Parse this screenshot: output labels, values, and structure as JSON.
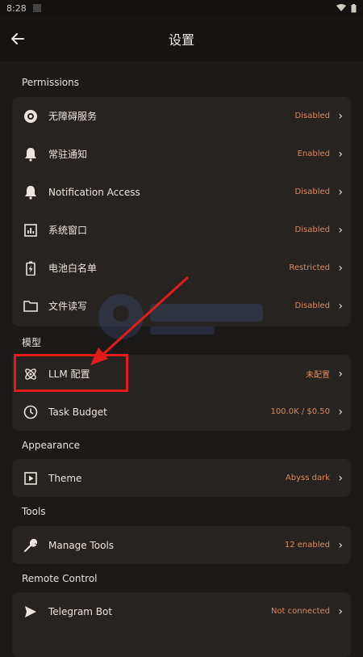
{
  "status": {
    "time": "8:28"
  },
  "header": {
    "title": "设置"
  },
  "sections": [
    {
      "label": "Permissions",
      "items": [
        {
          "icon": "target-icon",
          "label": "无障碍服务",
          "value": "Disabled"
        },
        {
          "icon": "bell-icon",
          "label": "常驻通知",
          "value": "Enabled"
        },
        {
          "icon": "bell-icon",
          "label": "Notification Access",
          "value": "Disabled"
        },
        {
          "icon": "bar-chart-icon",
          "label": "系统窗口",
          "value": "Disabled"
        },
        {
          "icon": "battery-icon",
          "label": "电池白名单",
          "value": "Restricted"
        },
        {
          "icon": "folder-icon",
          "label": "文件读写",
          "value": "Disabled"
        }
      ]
    },
    {
      "label": "模型",
      "items": [
        {
          "icon": "atom-icon",
          "label": "LLM 配置",
          "value": "未配置"
        },
        {
          "icon": "clock-icon",
          "label": "Task Budget",
          "value": "100.0K / $0.50"
        }
      ]
    },
    {
      "label": "Appearance",
      "items": [
        {
          "icon": "play-square-icon",
          "label": "Theme",
          "value": "Abyss dark"
        }
      ]
    },
    {
      "label": "Tools",
      "items": [
        {
          "icon": "wrench-icon",
          "label": "Manage Tools",
          "value": "12 enabled"
        }
      ]
    },
    {
      "label": "Remote Control",
      "items": [
        {
          "icon": "send-icon",
          "label": "Telegram Bot",
          "value": "Not connected"
        }
      ]
    }
  ],
  "colors": {
    "background": "#1c1a18",
    "card": "#262320",
    "accent": "#e08a5a",
    "annotation": "#e21b1b"
  }
}
